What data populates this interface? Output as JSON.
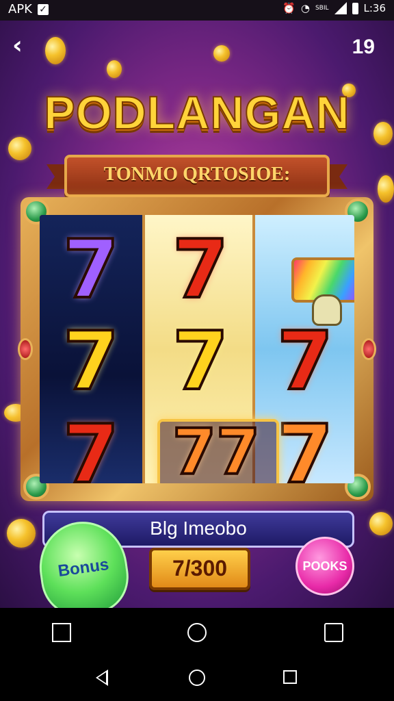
{
  "status_bar": {
    "app_label": "APK",
    "notification_icon": "check-icon",
    "signal_label": "SBIL",
    "time": "L:36"
  },
  "header": {
    "back_icon": "chevron-left-icon",
    "level": "19"
  },
  "game": {
    "title": "PODLANGAN",
    "subtitle": "TONMO QRTOSIOE:",
    "reels": [
      [
        "7",
        "7",
        "7"
      ],
      [
        "7",
        "7",
        "77"
      ],
      [
        "rainbow-symbol",
        "7",
        "7"
      ]
    ],
    "info_text": "Blg Imeobo",
    "credits": "7/300",
    "bonus_label": "Bonus",
    "pooks_label": "POOKS"
  },
  "soft_keys": [
    "screenshot-icon",
    "home-circle-icon",
    "crop-icon"
  ],
  "nav": [
    "back-triangle-icon",
    "home-icon",
    "recents-icon"
  ],
  "colors": {
    "background": "#5a1d7a",
    "title_gold": "#ffd43a",
    "frame_gold": "#e8b25a"
  }
}
